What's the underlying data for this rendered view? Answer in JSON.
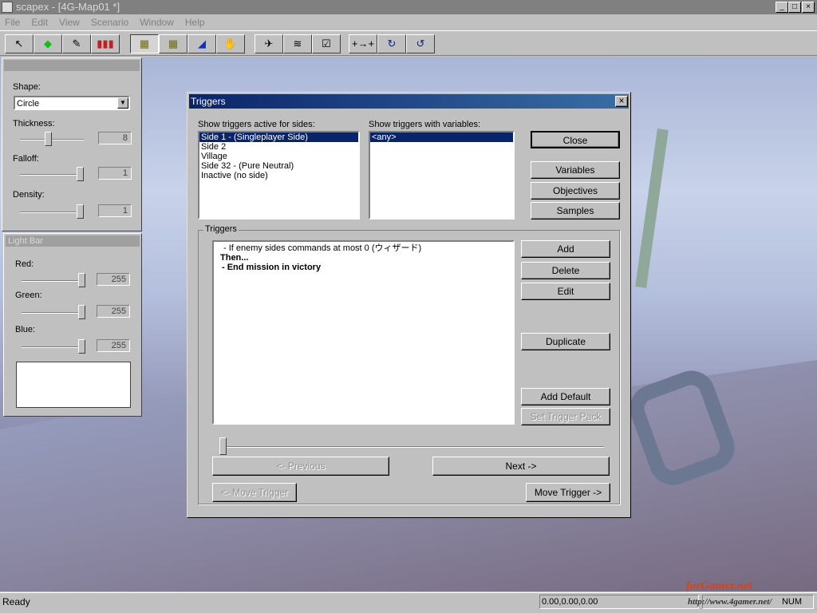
{
  "window": {
    "title": "scapex - [4G-Map01 *]",
    "min": "_",
    "max": "□",
    "close": "×"
  },
  "menu": [
    "File",
    "Edit",
    "View",
    "Scenario",
    "Window",
    "Help"
  ],
  "toolbar": [
    {
      "icon": "arrow-select-icon",
      "glyph": "↖"
    },
    {
      "icon": "green-gem-icon",
      "glyph": "◆",
      "color": "#10c010"
    },
    {
      "icon": "brush-icon",
      "glyph": "✎"
    },
    {
      "icon": "color-bars-icon",
      "glyph": "▮▮▮",
      "color": "#c02020"
    },
    {
      "icon": "terrain-raise-icon",
      "glyph": "▦",
      "color": "#6b6b20"
    },
    {
      "icon": "terrain-lower-icon",
      "glyph": "▦",
      "color": "#6b6b20"
    },
    {
      "icon": "terrain-water-icon",
      "glyph": "◢",
      "color": "#1030c0"
    },
    {
      "icon": "place-hand-icon",
      "glyph": "✋"
    },
    {
      "icon": "object-icon",
      "glyph": "✈"
    },
    {
      "icon": "paths-icon",
      "glyph": "≋"
    },
    {
      "icon": "properties-icon",
      "glyph": "☑"
    },
    {
      "icon": "waypoint-icon",
      "glyph": "+→+"
    },
    {
      "icon": "rotate-cw-icon",
      "glyph": "↻",
      "color": "#102080"
    },
    {
      "icon": "rotate-ccw-icon",
      "glyph": "↺",
      "color": "#102080"
    }
  ],
  "brush": {
    "shape_label": "Shape:",
    "shape_value": "Circle",
    "thickness_label": "Thickness:",
    "thickness": "8",
    "falloff_label": "Falloff:",
    "falloff": "1",
    "density_label": "Density:",
    "density": "1"
  },
  "light": {
    "title": "Light Bar",
    "red_label": "Red:",
    "red": "255",
    "green_label": "Green:",
    "green": "255",
    "blue_label": "Blue:",
    "blue": "255"
  },
  "dialog": {
    "title": "Triggers",
    "sides_label": "Show triggers active for sides:",
    "sides": [
      "Side 1 - (Singleplayer Side)",
      "Side 2",
      "Village",
      "Side 32 - (Pure Neutral)",
      "Inactive (no side)"
    ],
    "vars_label": "Show triggers with variables:",
    "vars": [
      "<any>"
    ],
    "close": "Close",
    "variables": "Variables",
    "objectives": "Objectives",
    "samples": "Samples",
    "group": "Triggers",
    "lines": [
      "- If enemy sides commands at most 0 (ウィザード)",
      "Then...",
      "- End mission in victory"
    ],
    "add": "Add",
    "delete": "Delete",
    "edit": "Edit",
    "duplicate": "Duplicate",
    "add_default": "Add Default",
    "set_pack": "Set Trigger Pack",
    "previous": "<- Previous",
    "next": "Next ->",
    "move_left": "<- Move Trigger",
    "move_right": "Move Trigger ->"
  },
  "status": {
    "text": "Ready",
    "coords": "0.00,0.00,0.00",
    "num": "NUM"
  },
  "watermark": {
    "brand": "4Gamer.net",
    "site": "forGamer.net",
    "url": "http://www.4gamer.net/"
  }
}
